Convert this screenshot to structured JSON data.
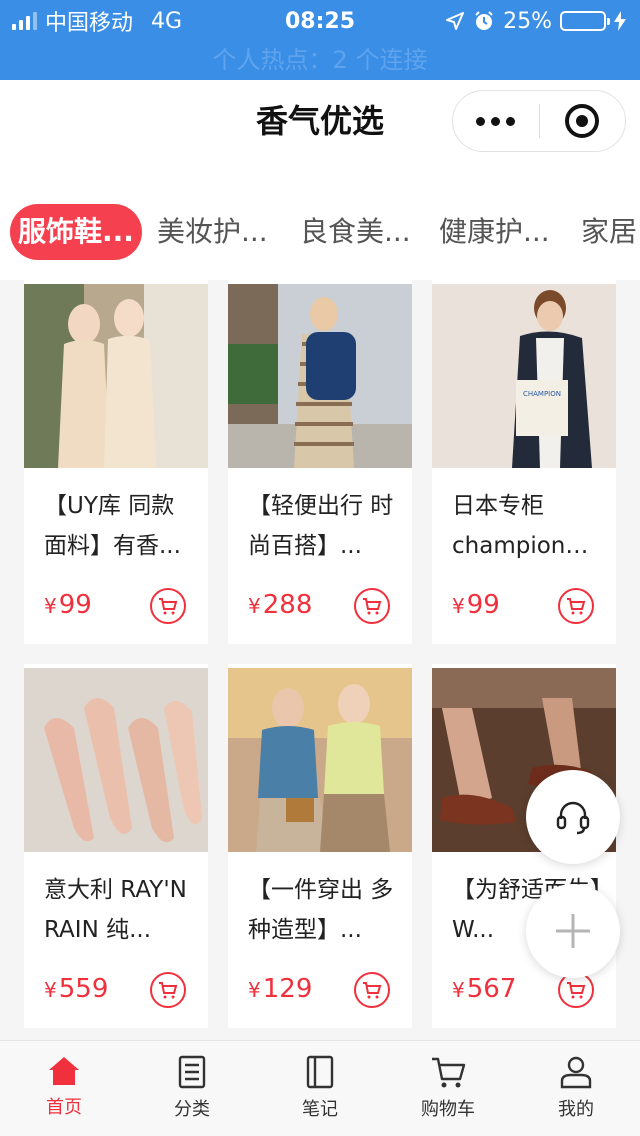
{
  "status_bar": {
    "carrier": "中国移动",
    "network": "4G",
    "time": "08:25",
    "battery": "25%",
    "battery_level": 0.25,
    "hotspot": "个人热点：2 个连接"
  },
  "nav": {
    "title": "香气优选"
  },
  "tabs": [
    {
      "label": "服饰鞋...",
      "active": true
    },
    {
      "label": "美妆护...",
      "active": false
    },
    {
      "label": "良食美...",
      "active": false
    },
    {
      "label": "健康护...",
      "active": false
    },
    {
      "label": "家居",
      "active": false
    }
  ],
  "products": [
    {
      "name": "【UY库 同款面料】有香...",
      "currency": "¥",
      "price": "99"
    },
    {
      "name": "【轻便出行 时尚百搭】...",
      "currency": "¥",
      "price": "288"
    },
    {
      "name": "日本专柜champion秋冬...",
      "currency": "¥",
      "price": "99"
    },
    {
      "name": "意大利 RAY'N RAIN 纯...",
      "currency": "¥",
      "price": "559"
    },
    {
      "name": "【一件穿出 多种造型】...",
      "currency": "¥",
      "price": "129"
    },
    {
      "name": "【为舒适而生】W...",
      "currency": "¥",
      "price": "567"
    }
  ],
  "tabbar": [
    {
      "label": "首页",
      "icon": "home-icon",
      "active": true
    },
    {
      "label": "分类",
      "icon": "category-icon",
      "active": false
    },
    {
      "label": "笔记",
      "icon": "notebook-icon",
      "active": false
    },
    {
      "label": "购物车",
      "icon": "cart-icon",
      "active": false
    },
    {
      "label": "我的",
      "icon": "user-icon",
      "active": false
    }
  ],
  "colors": {
    "accent": "#f0303c",
    "status_bar": "#3a8ee6"
  }
}
